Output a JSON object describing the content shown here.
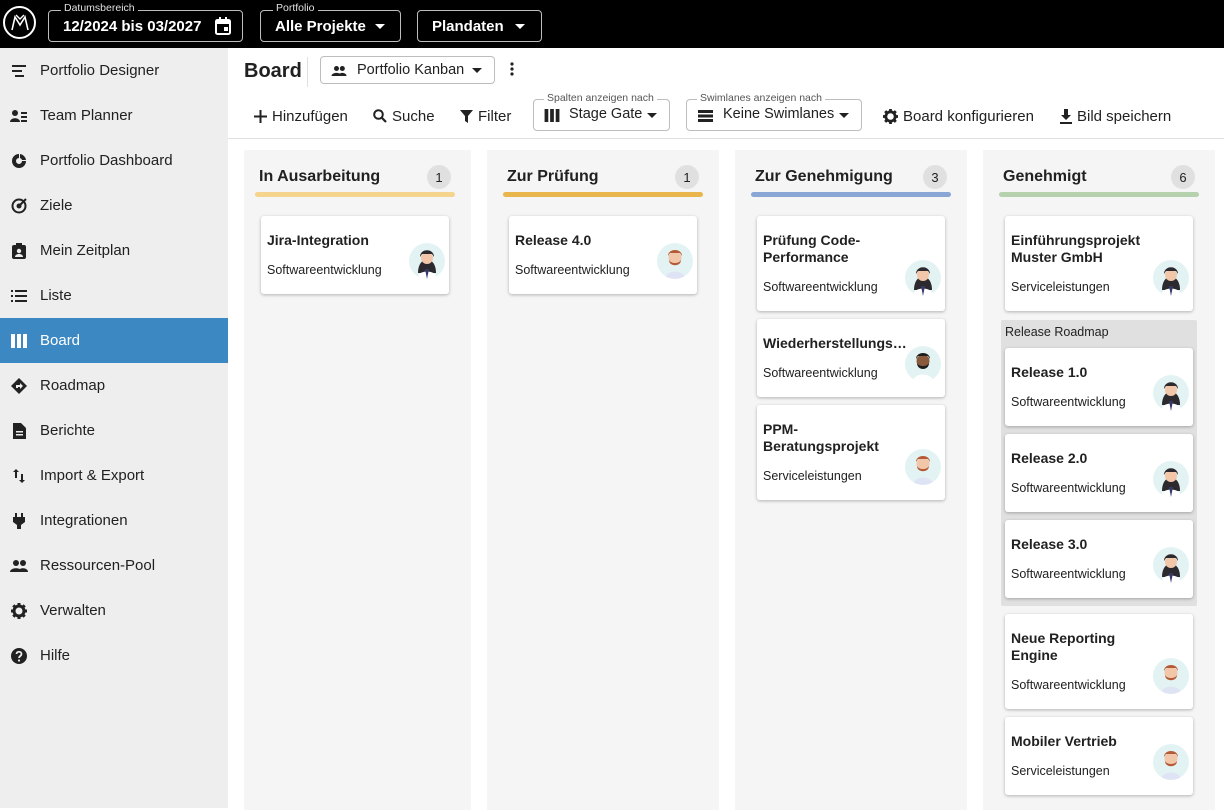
{
  "topbar": {
    "date_label": "Datumsbereich",
    "date_value": "12/2024 bis 03/2027",
    "portfolio_label": "Portfolio",
    "portfolio_value": "Alle Projekte",
    "data_value": "Plandaten"
  },
  "sidebar": {
    "items": [
      {
        "label": "Portfolio Designer",
        "icon": "portfolio-designer-icon"
      },
      {
        "label": "Team Planner",
        "icon": "team-planner-icon"
      },
      {
        "label": "Portfolio Dashboard",
        "icon": "dashboard-icon"
      },
      {
        "label": "Ziele",
        "icon": "target-icon"
      },
      {
        "label": "Mein Zeitplan",
        "icon": "schedule-icon"
      },
      {
        "label": "Liste",
        "icon": "list-icon"
      },
      {
        "label": "Board",
        "icon": "board-icon",
        "active": true
      },
      {
        "label": "Roadmap",
        "icon": "roadmap-icon"
      },
      {
        "label": "Berichte",
        "icon": "report-icon"
      },
      {
        "label": "Import & Export",
        "icon": "import-export-icon"
      },
      {
        "label": "Integrationen",
        "icon": "plug-icon"
      },
      {
        "label": "Ressourcen-Pool",
        "icon": "people-icon"
      },
      {
        "label": "Verwalten",
        "icon": "gear-icon"
      },
      {
        "label": "Hilfe",
        "icon": "help-icon"
      }
    ]
  },
  "header": {
    "title": "Board",
    "view_select": "Portfolio Kanban"
  },
  "toolbar": {
    "add": "Hinzufügen",
    "search": "Suche",
    "filter": "Filter",
    "columns_label": "Spalten anzeigen nach",
    "columns_value": "Stage Gate",
    "swimlanes_label": "Swimlanes anzeigen nach",
    "swimlanes_value": "Keine Swimlanes",
    "configure": "Board konfigurieren",
    "save_image": "Bild speichern"
  },
  "columns": [
    {
      "title": "In Ausarbeitung",
      "count": "1",
      "color": "#f5d58e",
      "cards": [
        {
          "title": "Jira-Integration",
          "subtitle": "Softwareentwicklung"
        }
      ]
    },
    {
      "title": "Zur Prüfung",
      "count": "1",
      "color": "#e8b64c",
      "cards": [
        {
          "title": "Release 4.0",
          "subtitle": "Softwareentwicklung"
        }
      ]
    },
    {
      "title": "Zur Genehmigung",
      "count": "3",
      "color": "#8aa6d4",
      "cards": [
        {
          "title": "Prüfung Code-Performance",
          "subtitle": "Softwareentwicklung"
        },
        {
          "title": "Wiederherstellungs…",
          "subtitle": "Softwareentwicklung"
        },
        {
          "title": "PPM-Beratungsprojekt",
          "subtitle": "Serviceleistungen"
        }
      ]
    },
    {
      "title": "Genehmigt",
      "count": "6",
      "color": "#b6d1ad",
      "cards": [
        {
          "title": "Einführungsprojekt Muster GmbH",
          "subtitle": "Serviceleistungen"
        },
        {
          "title": "Neue Reporting Engine",
          "subtitle": "Softwareentwicklung"
        },
        {
          "title": "Mobiler Vertrieb",
          "subtitle": "Serviceleistungen"
        }
      ],
      "lane": {
        "title": "Release Roadmap",
        "cards": [
          {
            "title": "Release 1.0",
            "subtitle": "Softwareentwicklung"
          },
          {
            "title": "Release 2.0",
            "subtitle": "Softwareentwicklung"
          },
          {
            "title": "Release 3.0",
            "subtitle": "Softwareentwicklung"
          }
        ]
      }
    }
  ]
}
